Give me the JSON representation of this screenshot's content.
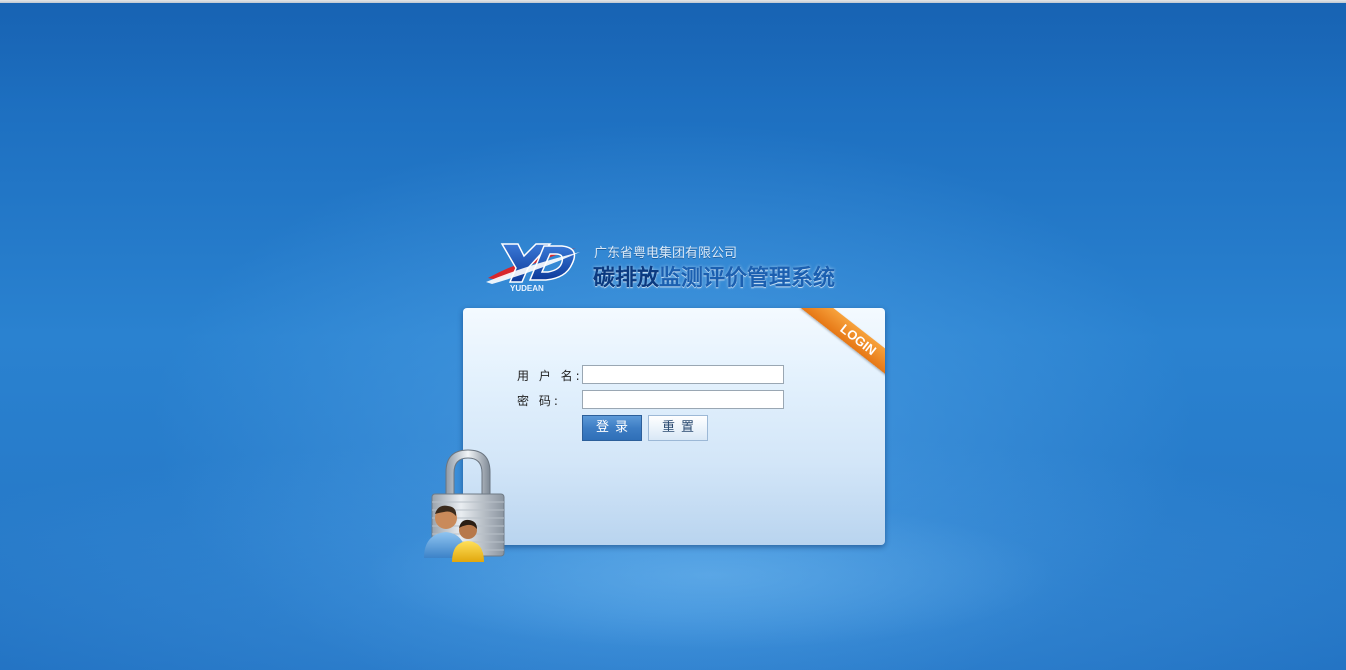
{
  "header": {
    "logo_text": "YUDEAN",
    "company_name": "广东省粤电集团有限公司",
    "system_title_part_a": "碳排放",
    "system_title_part_b": "监测评价管理系统"
  },
  "login_panel": {
    "ribbon_label": "LOGIN",
    "username_label": "用 户 名:",
    "username_value": "",
    "password_label": "密    码:",
    "password_value": "",
    "login_button": "登录",
    "reset_button": "重置"
  },
  "icons": {
    "logo": "yudean-logo",
    "lock": "padlock-users-icon"
  },
  "colors": {
    "background": "#1f73c2",
    "title_dark": "#0b3a80",
    "title_light": "#1b5fb0",
    "ribbon": "#f08a24",
    "login_button": "#3d7dc4"
  }
}
